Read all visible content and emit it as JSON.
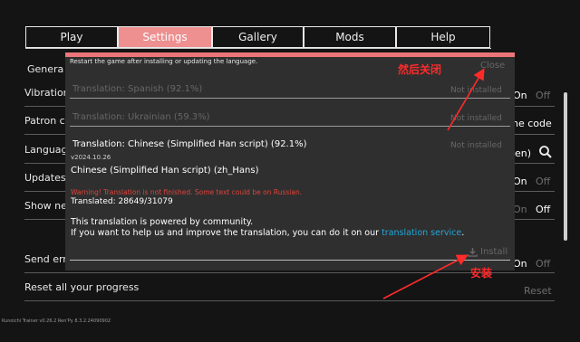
{
  "tabs": [
    {
      "label": "Play"
    },
    {
      "label": "Settings"
    },
    {
      "label": "Gallery"
    },
    {
      "label": "Mods"
    },
    {
      "label": "Help"
    }
  ],
  "settings": {
    "general_heading": "Genera",
    "rows": [
      {
        "label": "Vibration",
        "on": "On",
        "off": "Off"
      },
      {
        "label": "Patron co",
        "value": "ne code"
      },
      {
        "label": "Languag",
        "value": "en)"
      },
      {
        "label": "Updates",
        "on": "On",
        "off": "Off"
      },
      {
        "label": "Show nev",
        "on": "On",
        "off": "Off"
      },
      {
        "label": "Send err",
        "on": "On",
        "off": "Off"
      },
      {
        "label": "Reset all your progress",
        "value": "Reset"
      }
    ]
  },
  "dialog": {
    "notice": "Restart the game after installing or updating the language.",
    "close_label": "Close",
    "items": [
      {
        "title": "Translation: Spanish (92.1%)",
        "status": "Not installed"
      },
      {
        "title": "Translation: Ukrainian (59.3%)",
        "status": "Not installed"
      },
      {
        "title": "Translation: Chinese (Simplified Han script) (92.1%)",
        "status": "Not installed"
      }
    ],
    "version": "v2024.10.26",
    "language_name": "Chinese (Simplified Han script) (zh_Hans)",
    "warning": "Warning! Translation is not finished. Some text could be on Russian.",
    "translated": "Translated: 28649/31079",
    "community_line1": "This translation is powered by community.",
    "community_line2": "If you want to help us and improve the translation, you can do it on our",
    "service_link": "translation service",
    "period": ".",
    "install_label": "Install"
  },
  "annotations": {
    "close_note": "然后关闭",
    "install_note": "安装"
  },
  "footer": {
    "version": "Kunoichi Trainer v0.26.2    Ren'Py 8.3.2.24090902"
  },
  "colors": {
    "accent": "#ee8f90",
    "dialog_bg": "#2f2f2f",
    "warning": "#e0423a",
    "link": "#21a7d9",
    "annotation": "#ff2b2b"
  }
}
